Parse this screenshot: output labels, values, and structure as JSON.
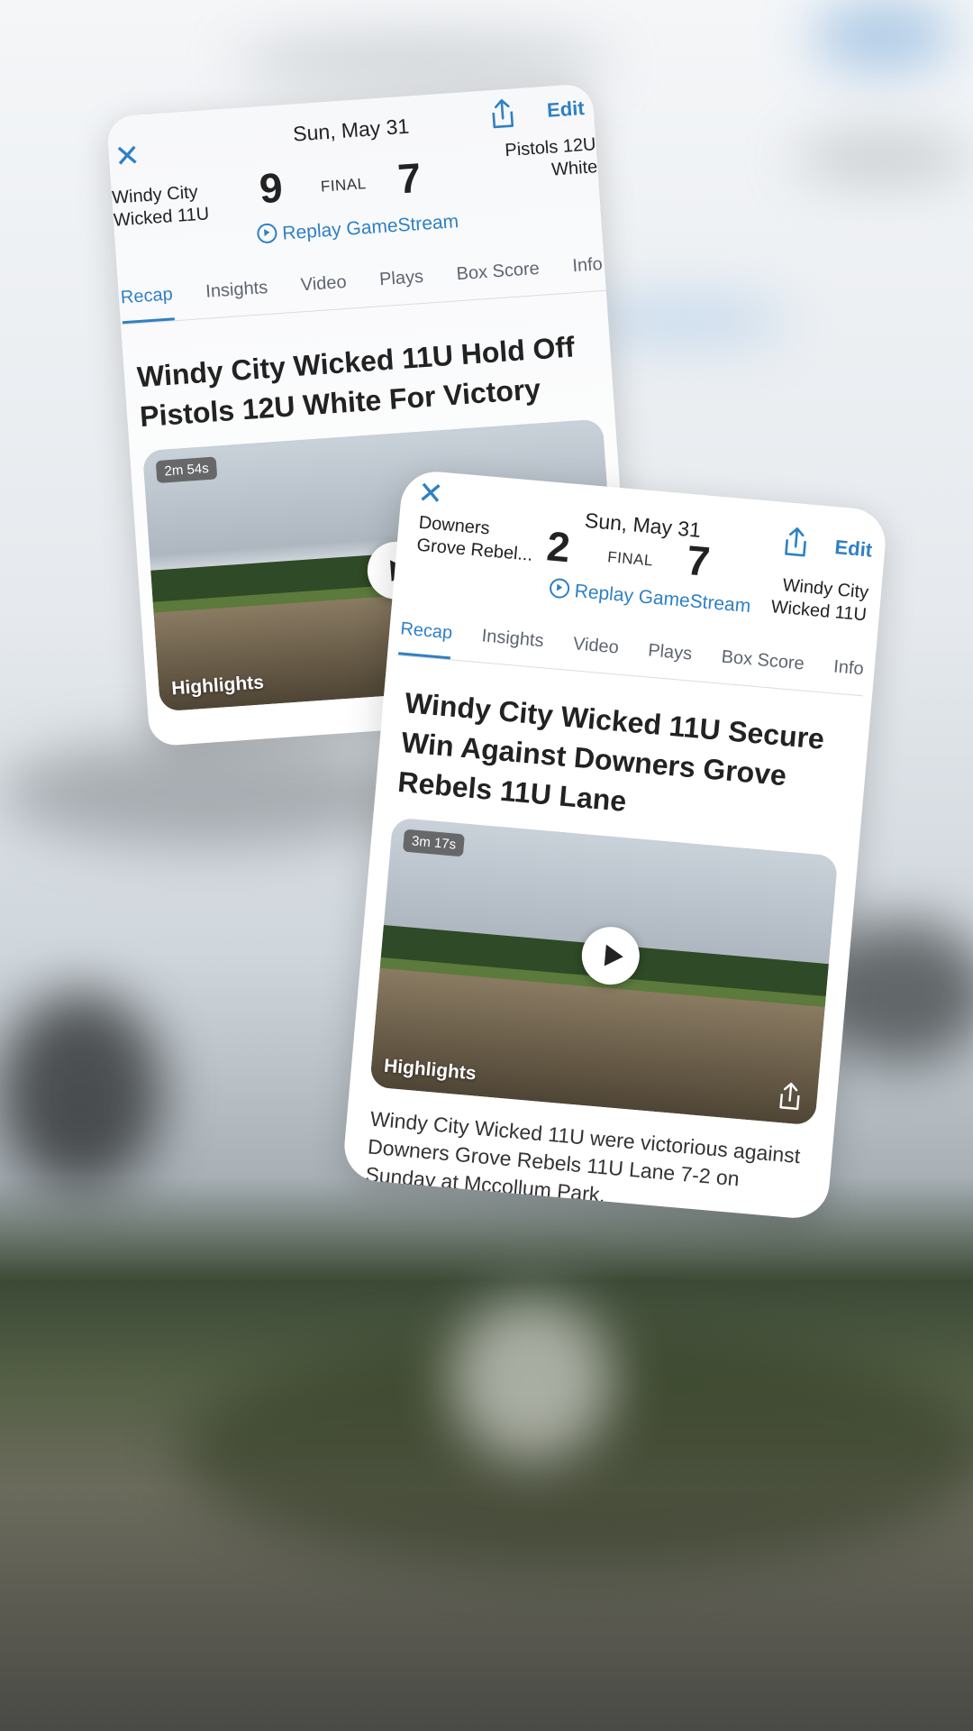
{
  "back_card": {
    "close_label": "✕",
    "date": "Sun, May 31",
    "edit_label": "Edit",
    "home_team": "Windy City\nWicked 11U",
    "home_score": "9",
    "status": "FINAL",
    "away_score": "7",
    "away_team": "Pistols 12U\nWhite",
    "replay_label": "Replay GameStream",
    "tabs": [
      "Recap",
      "Insights",
      "Video",
      "Plays",
      "Box Score",
      "Info"
    ],
    "headline": "Windy City Wicked 11U Hold Off Pistols 12U White For Victory",
    "video_duration": "2m 54s",
    "video_label": "Highlights"
  },
  "front_card": {
    "close_label": "✕",
    "date": "Sun, May 31",
    "edit_label": "Edit",
    "home_team": "Downers\nGrove Rebel...",
    "home_score": "2",
    "status": "FINAL",
    "away_score": "7",
    "away_team": "Windy City\nWicked 11U",
    "replay_label": "Replay GameStream",
    "tabs": [
      "Recap",
      "Insights",
      "Video",
      "Plays",
      "Box Score",
      "Info"
    ],
    "headline": "Windy City Wicked 11U Secure Win Against Downers Grove Rebels 11U Lane",
    "video_duration": "3m 17s",
    "video_label": "Highlights",
    "summary": "Windy City Wicked 11U were victorious against Downers Grove Rebels 11U Lane 7-2 on Sunday at Mccollum Park."
  },
  "colors": {
    "accent": "#2f80c4",
    "text": "#222222",
    "tab_inactive": "#5e6470"
  }
}
